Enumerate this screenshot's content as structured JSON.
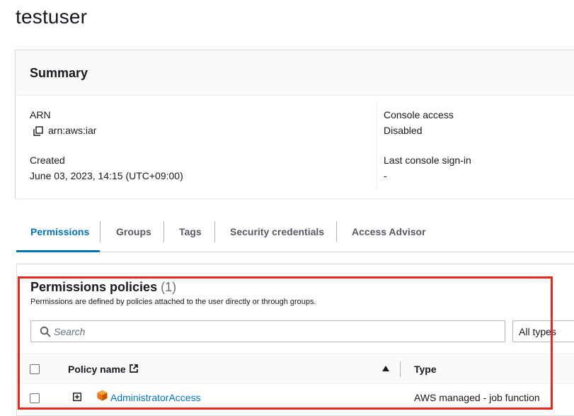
{
  "page": {
    "title": "testuser"
  },
  "summary": {
    "title": "Summary",
    "arn_label": "ARN",
    "arn_value": "arn:aws:iar",
    "created_label": "Created",
    "created_value": "June 03, 2023, 14:15 (UTC+09:00)",
    "console_access_label": "Console access",
    "console_access_value": "Disabled",
    "last_signin_label": "Last console sign-in",
    "last_signin_value": "-"
  },
  "tabs": [
    {
      "label": "Permissions",
      "active": true
    },
    {
      "label": "Groups",
      "active": false
    },
    {
      "label": "Tags",
      "active": false
    },
    {
      "label": "Security credentials",
      "active": false
    },
    {
      "label": "Access Advisor",
      "active": false
    }
  ],
  "permissions": {
    "title": "Permissions policies",
    "count": "(1)",
    "description": "Permissions are defined by policies attached to the user directly or through groups.",
    "search_placeholder": "Search",
    "filter_value": "All types",
    "columns": {
      "policy_name": "Policy name",
      "type": "Type"
    },
    "rows": [
      {
        "policy_name": "AdministratorAccess",
        "type": "AWS managed - job function"
      }
    ]
  },
  "colors": {
    "accent": "#0073bb",
    "highlight": "#e8281f",
    "policy_icon": "#ec7211"
  },
  "icons": [
    "copy-icon",
    "external-link-icon",
    "sort-ascending-icon",
    "search-icon",
    "expand-icon",
    "policy-cube-icon"
  ]
}
